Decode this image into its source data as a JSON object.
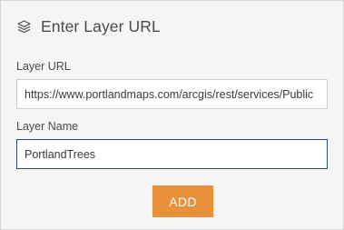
{
  "header": {
    "icon": "layers-icon",
    "title": "Enter Layer URL"
  },
  "layer_url": {
    "label": "Layer URL",
    "value": "https://www.portlandmaps.com/arcgis/rest/services/Public"
  },
  "layer_name": {
    "label": "Layer Name",
    "value": "PortlandTrees"
  },
  "actions": {
    "add_label": "ADD"
  },
  "colors": {
    "accent": "#e8913a",
    "focus_border": "#2e4a7a",
    "background": "#f5f5f5"
  }
}
